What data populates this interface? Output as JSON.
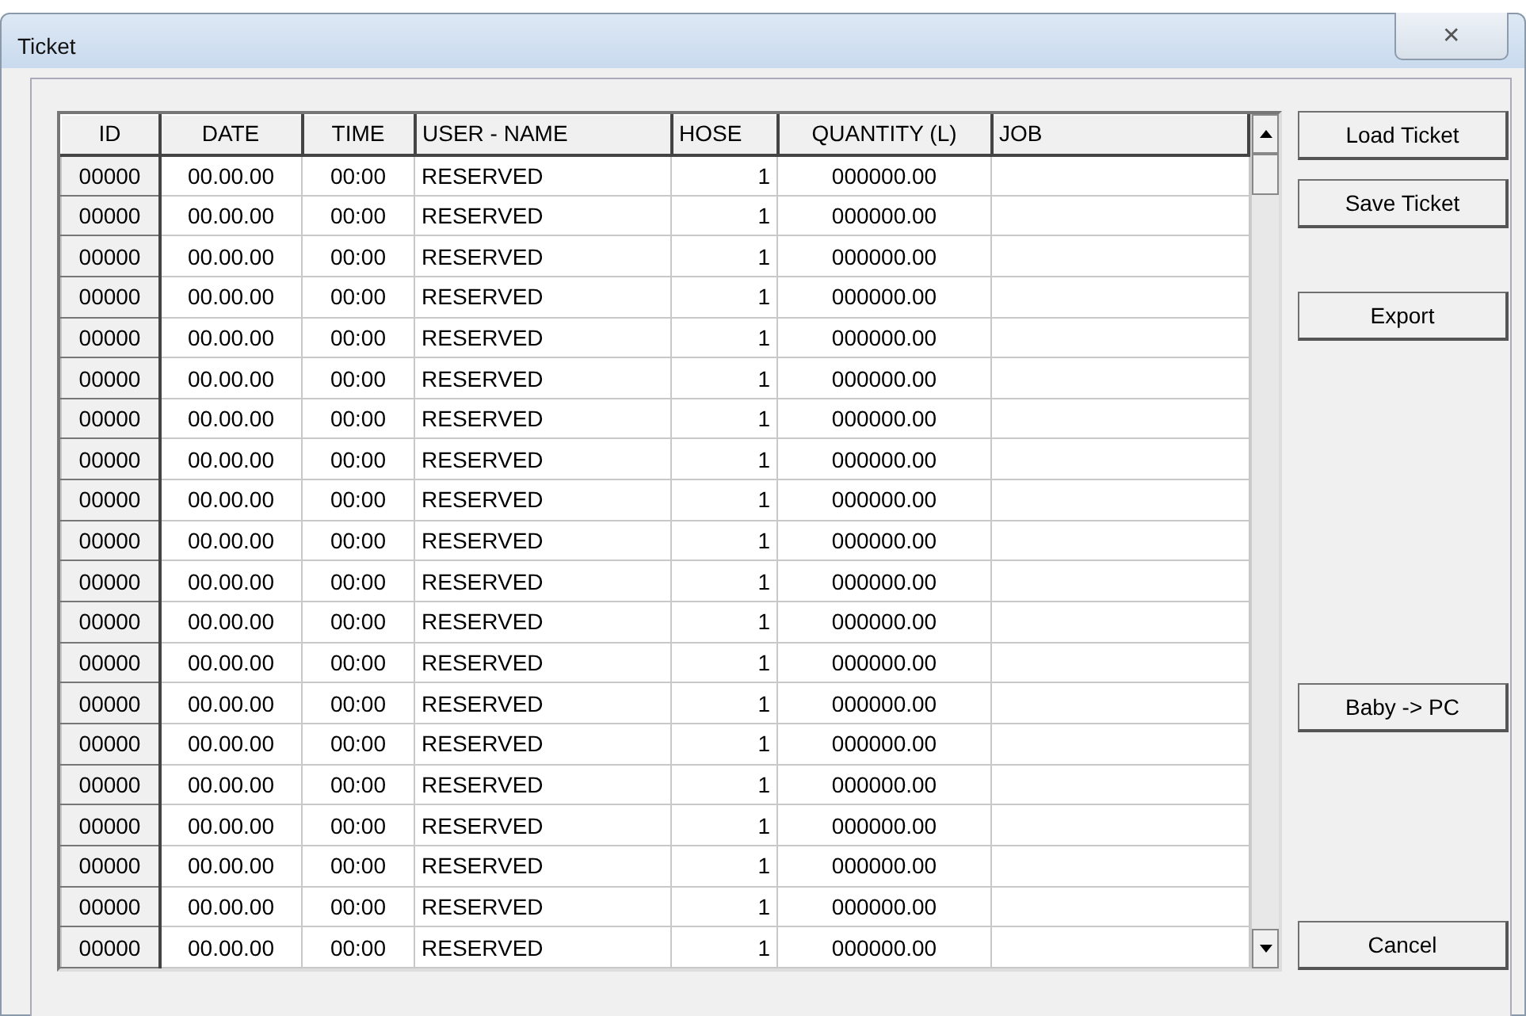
{
  "window": {
    "title": "Ticket",
    "close": "✕"
  },
  "table": {
    "columns": [
      "ID",
      "DATE",
      "TIME",
      "USER - NAME",
      "HOSE",
      "QUANTITY (L)",
      "JOB"
    ],
    "rows": [
      {
        "id": "00000",
        "date": "00.00.00",
        "time": "00:00",
        "user": "RESERVED",
        "hose": "1",
        "quantity": "000000.00"
      },
      {
        "id": "00000",
        "date": "00.00.00",
        "time": "00:00",
        "user": "RESERVED",
        "hose": "1",
        "quantity": "000000.00"
      },
      {
        "id": "00000",
        "date": "00.00.00",
        "time": "00:00",
        "user": "RESERVED",
        "hose": "1",
        "quantity": "000000.00"
      },
      {
        "id": "00000",
        "date": "00.00.00",
        "time": "00:00",
        "user": "RESERVED",
        "hose": "1",
        "quantity": "000000.00"
      },
      {
        "id": "00000",
        "date": "00.00.00",
        "time": "00:00",
        "user": "RESERVED",
        "hose": "1",
        "quantity": "000000.00"
      },
      {
        "id": "00000",
        "date": "00.00.00",
        "time": "00:00",
        "user": "RESERVED",
        "hose": "1",
        "quantity": "000000.00"
      },
      {
        "id": "00000",
        "date": "00.00.00",
        "time": "00:00",
        "user": "RESERVED",
        "hose": "1",
        "quantity": "000000.00"
      },
      {
        "id": "00000",
        "date": "00.00.00",
        "time": "00:00",
        "user": "RESERVED",
        "hose": "1",
        "quantity": "000000.00"
      },
      {
        "id": "00000",
        "date": "00.00.00",
        "time": "00:00",
        "user": "RESERVED",
        "hose": "1",
        "quantity": "000000.00"
      },
      {
        "id": "00000",
        "date": "00.00.00",
        "time": "00:00",
        "user": "RESERVED",
        "hose": "1",
        "quantity": "000000.00"
      },
      {
        "id": "00000",
        "date": "00.00.00",
        "time": "00:00",
        "user": "RESERVED",
        "hose": "1",
        "quantity": "000000.00"
      },
      {
        "id": "00000",
        "date": "00.00.00",
        "time": "00:00",
        "user": "RESERVED",
        "hose": "1",
        "quantity": "000000.00"
      },
      {
        "id": "00000",
        "date": "00.00.00",
        "time": "00:00",
        "user": "RESERVED",
        "hose": "1",
        "quantity": "000000.00"
      },
      {
        "id": "00000",
        "date": "00.00.00",
        "time": "00:00",
        "user": "RESERVED",
        "hose": "1",
        "quantity": "000000.00"
      },
      {
        "id": "00000",
        "date": "00.00.00",
        "time": "00:00",
        "user": "RESERVED",
        "hose": "1",
        "quantity": "000000.00"
      },
      {
        "id": "00000",
        "date": "00.00.00",
        "time": "00:00",
        "user": "RESERVED",
        "hose": "1",
        "quantity": "000000.00"
      },
      {
        "id": "00000",
        "date": "00.00.00",
        "time": "00:00",
        "user": "RESERVED",
        "hose": "1",
        "quantity": "000000.00"
      },
      {
        "id": "00000",
        "date": "00.00.00",
        "time": "00:00",
        "user": "RESERVED",
        "hose": "1",
        "quantity": "000000.00"
      },
      {
        "id": "00000",
        "date": "00.00.00",
        "time": "00:00",
        "user": "RESERVED",
        "hose": "1",
        "quantity": "000000.00"
      },
      {
        "id": "00000",
        "date": "00.00.00",
        "time": "00:00",
        "user": "RESERVED",
        "hose": "1",
        "quantity": "000000.00"
      }
    ]
  },
  "buttons": [
    "Load Ticket",
    "Save Ticket",
    "Export",
    "Baby -> PC",
    "Cancel"
  ]
}
